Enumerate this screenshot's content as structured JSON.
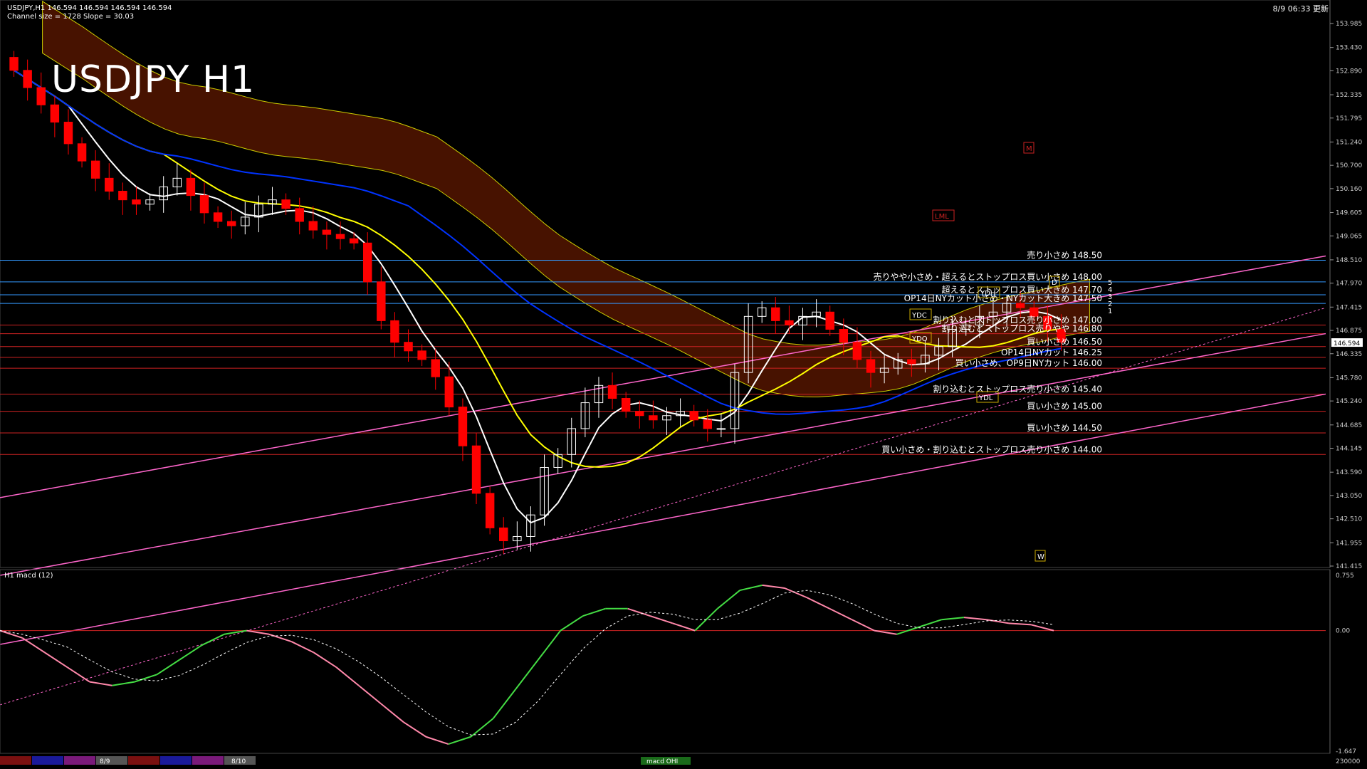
{
  "chart_window": {
    "header_line1": "USDJPY,H1  146.594 146.594 146.594 146.594",
    "header_line2": "Channel size = 1728 Slope = 30.03",
    "big_title": "USDJPY H1",
    "datetime": "8/9 06:33 更新",
    "macd_header": "H1  macd (12)",
    "day_labels": [
      "8/9",
      "8/10"
    ],
    "bottom_badge": "macd OHI",
    "bottom_right": "230000",
    "colors": {
      "background": "#000000",
      "up_candle": "#ffffff",
      "down_candle": "#ff0000",
      "channel": "#ff66cc",
      "kumo": "#cc3300",
      "sma_yellow": "#ffff00",
      "sma_blue": "#0033ff",
      "sma_white": "#ffffff",
      "macd_up": "#44dd44",
      "macd_down": "#ff88aa"
    }
  },
  "chart_data": [
    {
      "type": "line",
      "name": "price-panel",
      "ylim": [
        141.415,
        154.2
      ],
      "y_ticks": [
        "153.985",
        "153.430",
        "152.890",
        "152.335",
        "151.795",
        "151.240",
        "150.700",
        "150.160",
        "149.605",
        "149.065",
        "148.510",
        "147.970",
        "147.415",
        "146.875",
        "146.335",
        "145.780",
        "145.240",
        "144.685",
        "144.145",
        "143.590",
        "143.050",
        "142.510",
        "141.955",
        "141.415"
      ],
      "current_price": "146.594",
      "series": [
        {
          "name": "",
          "kind": "close-approx",
          "values": [
            152.9,
            152.5,
            152.1,
            151.7,
            151.2,
            150.8,
            150.4,
            150.1,
            149.9,
            149.8,
            149.9,
            150.2,
            150.4,
            150.0,
            149.6,
            149.4,
            149.3,
            149.5,
            149.8,
            149.9,
            149.7,
            149.4,
            149.2,
            149.1,
            149.0,
            148.9,
            148.0,
            147.1,
            146.6,
            146.4,
            146.2,
            145.8,
            145.1,
            144.2,
            143.1,
            142.3,
            142.0,
            142.1,
            142.6,
            143.7,
            144.0,
            144.6,
            145.2,
            145.6,
            145.3,
            145.0,
            144.9,
            144.8,
            144.9,
            145.0,
            144.8,
            144.6,
            144.6,
            145.9,
            147.2,
            147.4,
            147.1,
            147.0,
            147.2,
            147.3,
            146.9,
            146.6,
            146.2,
            145.9,
            146.0,
            146.2,
            146.1,
            146.3,
            146.5,
            146.9,
            147.0,
            147.2,
            147.3,
            147.5,
            147.4,
            147.2,
            146.9,
            146.6
          ]
        }
      ],
      "annotations": [
        {
          "text": "売り小さめ 148.50",
          "price": 148.5
        },
        {
          "text": "売りやや小さめ・超えるとストップロス買い小さめ 148.00",
          "price": 148.0
        },
        {
          "text": "超えるとストップロス買い大きめ 147.70",
          "price": 147.7
        },
        {
          "text": "OP14日NYカット小さめ・NYカット大きめ 147.50",
          "price": 147.5
        },
        {
          "text": "割り込むとストップロス売り小さめ 147.00",
          "price": 147.0
        },
        {
          "text": "割り込むとストップロス売りやや 146.80",
          "price": 146.8
        },
        {
          "text": "買い小さめ 146.50",
          "price": 146.5
        },
        {
          "text": "OP14日NYカット 146.25",
          "price": 146.25
        },
        {
          "text": "買い小さめ、OP9日NYカット 146.00",
          "price": 146.0
        },
        {
          "text": "割り込むとストップロス売り小さめ 145.40",
          "price": 145.4
        },
        {
          "text": "買い小さめ 145.00",
          "price": 145.0
        },
        {
          "text": "買い小さめ 144.50",
          "price": 144.5
        },
        {
          "text": "買い小さめ・割り込むとストップロス売り小さめ 144.00",
          "price": 144.0
        }
      ],
      "markers": [
        "YDC",
        "YDO",
        "YDH",
        "YDL",
        "LML",
        "M",
        "W",
        "D"
      ],
      "channel_labels": [
        "5",
        "4",
        "3",
        "2",
        "1"
      ]
    },
    {
      "type": "line",
      "name": "macd-panel",
      "ylim": [
        -1.647,
        0.755
      ],
      "y_ticks": [
        "0.755",
        "0.00",
        "-1.647"
      ],
      "series": [
        {
          "name": "",
          "kind": "macd-approx",
          "values": [
            0.0,
            -0.1,
            -0.3,
            -0.5,
            -0.7,
            -0.75,
            -0.7,
            -0.6,
            -0.4,
            -0.2,
            -0.05,
            0.0,
            -0.05,
            -0.15,
            -0.3,
            -0.5,
            -0.75,
            -1.0,
            -1.25,
            -1.45,
            -1.55,
            -1.45,
            -1.2,
            -0.8,
            -0.4,
            0.0,
            0.2,
            0.3,
            0.3,
            0.2,
            0.1,
            0.0,
            0.3,
            0.55,
            0.62,
            0.58,
            0.45,
            0.3,
            0.15,
            0.0,
            -0.05,
            0.05,
            0.15,
            0.18,
            0.15,
            0.1,
            0.08,
            0.0
          ]
        }
      ]
    }
  ]
}
